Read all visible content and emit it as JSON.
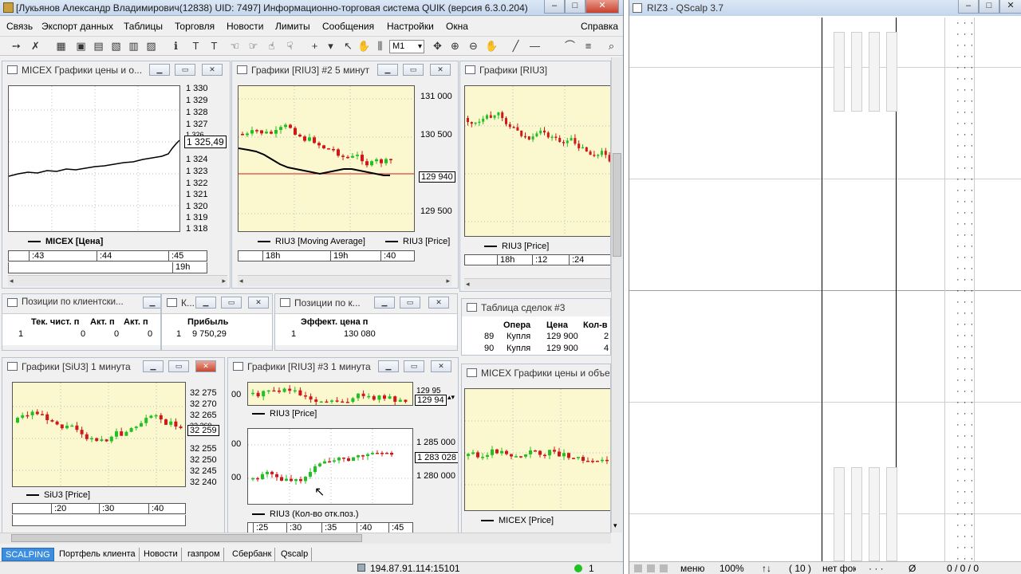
{
  "quik": {
    "title": "[Лукьянов Александр Владимирович(12838)  UID: 7497] Информационно-торговая система QUIK (версия 6.3.0.204)",
    "menu": [
      "Связь",
      "Экспорт данных",
      "Таблицы",
      "Торговля",
      "Новости",
      "Лимиты",
      "Сообщения",
      "Настройки",
      "Окна",
      "Справка"
    ],
    "toolbar": {
      "interval": "M1"
    },
    "windows": {
      "micex_chart": {
        "title": "MICEX Графики цены и о...",
        "y_ticks": [
          "1 330",
          "1 329",
          "1 328",
          "1 327",
          "1 326",
          "1 324",
          "1 323",
          "1 322",
          "1 321",
          "1 320",
          "1 319",
          "1 318"
        ],
        "price_label": "1 325,49",
        "legend": "MICEX [Цена]",
        "time_ticks": [
          ":43",
          ":44",
          ":45"
        ],
        "time_sub": "19h"
      },
      "riu3_5min": {
        "title": "Графики [RIU3] #2 5 минут",
        "y_ticks": [
          "131 000",
          "130 500",
          "129 500"
        ],
        "price_label": "129 940",
        "legend_ma": "RIU3 [Moving Average]",
        "legend_price": "RIU3 [Price]",
        "time_ticks": [
          "18h",
          "19h",
          ":40"
        ]
      },
      "riu3_chart": {
        "title": "Графики [RIU3]",
        "legend": "RIU3 [Price]",
        "time_ticks": [
          "18h",
          ":12",
          ":24"
        ]
      },
      "positions1": {
        "title": "Позиции по клиентски...",
        "headers": [
          "Тек. чист. п",
          "Акт. п",
          "Акт. п"
        ],
        "row": [
          "1",
          "0",
          "0",
          "0"
        ]
      },
      "small_k": {
        "title": "К...",
        "headers": [
          "Прибыль"
        ],
        "row": [
          "1",
          "9 750,29"
        ]
      },
      "positions2": {
        "title": "Позиции по к...",
        "headers": [
          "Эффект. цена п"
        ],
        "row": [
          "1",
          "130 080"
        ]
      },
      "trades": {
        "title": "Таблица сделок #3",
        "headers": [
          "Опера",
          "Цена",
          "Кол-в"
        ],
        "rows": [
          [
            "89",
            "Купля",
            "129 900",
            "2"
          ],
          [
            "90",
            "Купля",
            "129 900",
            "4"
          ]
        ]
      },
      "siu3_1min": {
        "title": "Графики [SiU3]  1 минута",
        "y_ticks": [
          "32 275",
          "32 270",
          "32 265",
          "32 260",
          "32 255",
          "32 250",
          "32 245",
          "32 240"
        ],
        "price_label": "32 259",
        "legend": "SiU3 [Price]",
        "time_ticks": [
          ":20",
          ":30",
          ":40"
        ]
      },
      "riu3_1min": {
        "title": "Графики [RIU3] #3 1 минута",
        "top_left_tick": "00",
        "top_price_label": "129 94",
        "top_tick_partial": "129 95",
        "legend_top": "RIU3 [Price]",
        "bottom_left_tick": "00",
        "bottom_left_tick2": "00",
        "y_ticks": [
          "1 285 000",
          "1 280 000"
        ],
        "price_label": "1 283 028",
        "legend_bottom": "RIU3 (Кол-во отк.поз.)",
        "time_ticks": [
          ":25",
          ":30",
          ":35",
          ":40",
          ":45"
        ]
      },
      "micex_chart2": {
        "title": "MICEX Графики цены и объем",
        "legend": "MICEX [Price]"
      }
    },
    "tabs": [
      "SCALPING",
      "Портфель клиента",
      "Новости",
      "газпром",
      "Сбербанк",
      "Qscalp"
    ],
    "status": {
      "connection": "194.87.91.114:15101",
      "count": "1"
    }
  },
  "qscalp": {
    "title": "RIZ3 - QScalp 3.7",
    "status": [
      "меню",
      "100%",
      "↑↓",
      "( 10 )",
      "нет фок",
      "· · ·",
      "Ø",
      "0 / 0 / 0"
    ]
  },
  "colors": {
    "up": "#22c022",
    "down": "#d01818",
    "accent": "#3c8fe0"
  }
}
